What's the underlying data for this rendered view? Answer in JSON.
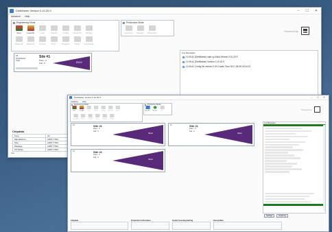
{
  "back_window": {
    "title": "DietMaster Version 0.10.20.9",
    "menu": [
      "Advance",
      "Help"
    ],
    "modes": {
      "engineering_label": "Engineering Mode",
      "production_label": "Production Mode",
      "engineering_tools": [
        "Start",
        "Load All",
        "Load",
        "Unlock",
        "Config",
        "Check ID",
        "ID Test"
      ],
      "production_tools": [
        "Auto Run",
        "Results",
        "Check Fix"
      ],
      "second_row": [
        "Read All",
        "Read All",
        "Unlock",
        "Burn",
        "Program",
        "Verify",
        "Auto Mode"
      ]
    },
    "brand_text": "Powered by",
    "brand_logo": "logo-icon",
    "site": {
      "tag": "#1",
      "name": "Site #1",
      "status": "IDLE",
      "info": [
        "DietMaster",
        "Pass :",
        "Fail :",
        "Start"
      ],
      "pass": "0",
      "fail": "0"
    },
    "log": {
      "title": "Log Messages",
      "lines": [
        "11:05:41 [DietMaster] start up Build Version 0.10.20.9",
        "11:05:41 [DietMaster] Version 0.10.20.9",
        "11:05:41 Config file version 0.90 Create Time 2017-08-08 18:34:22"
      ]
    },
    "chipdata": {
      "title": "Chipdata",
      "rows": [
        {
          "label": "Type",
          "value": "00"
        },
        {
          "label": "Manufacture",
          "value": "AIDP-YTDU"
        },
        {
          "label": "Size",
          "value": "AIDP-YTDU"
        },
        {
          "label": "Package",
          "value": "AIDP-YTDU"
        },
        {
          "label": "Pin Mode",
          "value": "AIDP-YTDU"
        }
      ]
    },
    "status_left": "Info"
  },
  "front_window": {
    "title": "DietMaster Version 0.10.20.9",
    "menu": [
      "Advance",
      "Help"
    ],
    "engineering_label": "Engineering Mode",
    "production_label": "Production Mode",
    "tools": [
      "Start",
      "Load All",
      "Load",
      "Unlock",
      "Config",
      "Check ID",
      "ID Test"
    ],
    "tools2": [
      "Read All",
      "Read",
      "Unlock",
      "Burn",
      "Program",
      "Verify"
    ],
    "prod_tools": [
      "Auto Run",
      "Results",
      "Stop"
    ],
    "brand_text": "Powered by",
    "sites": [
      {
        "tag": "#1",
        "name": "Site #1",
        "status": "IDLE",
        "pass": "0",
        "fail": "0"
      },
      {
        "tag": "#1",
        "name": "Site #1",
        "status": "IDLE",
        "pass": "0",
        "fail": "0"
      },
      {
        "tag": "#1",
        "name": "Site #1",
        "status": "IDLE",
        "pass": "0",
        "fail": "0"
      }
    ],
    "log_title": "Log Messages",
    "bottom": {
      "chipdata_title": "Chipdata",
      "production_title": "Production Information",
      "socket_title": "Socket Counting Setting",
      "stored_title": "Stored Data",
      "buttons": [
        "Settings",
        "Help/Log"
      ]
    }
  }
}
